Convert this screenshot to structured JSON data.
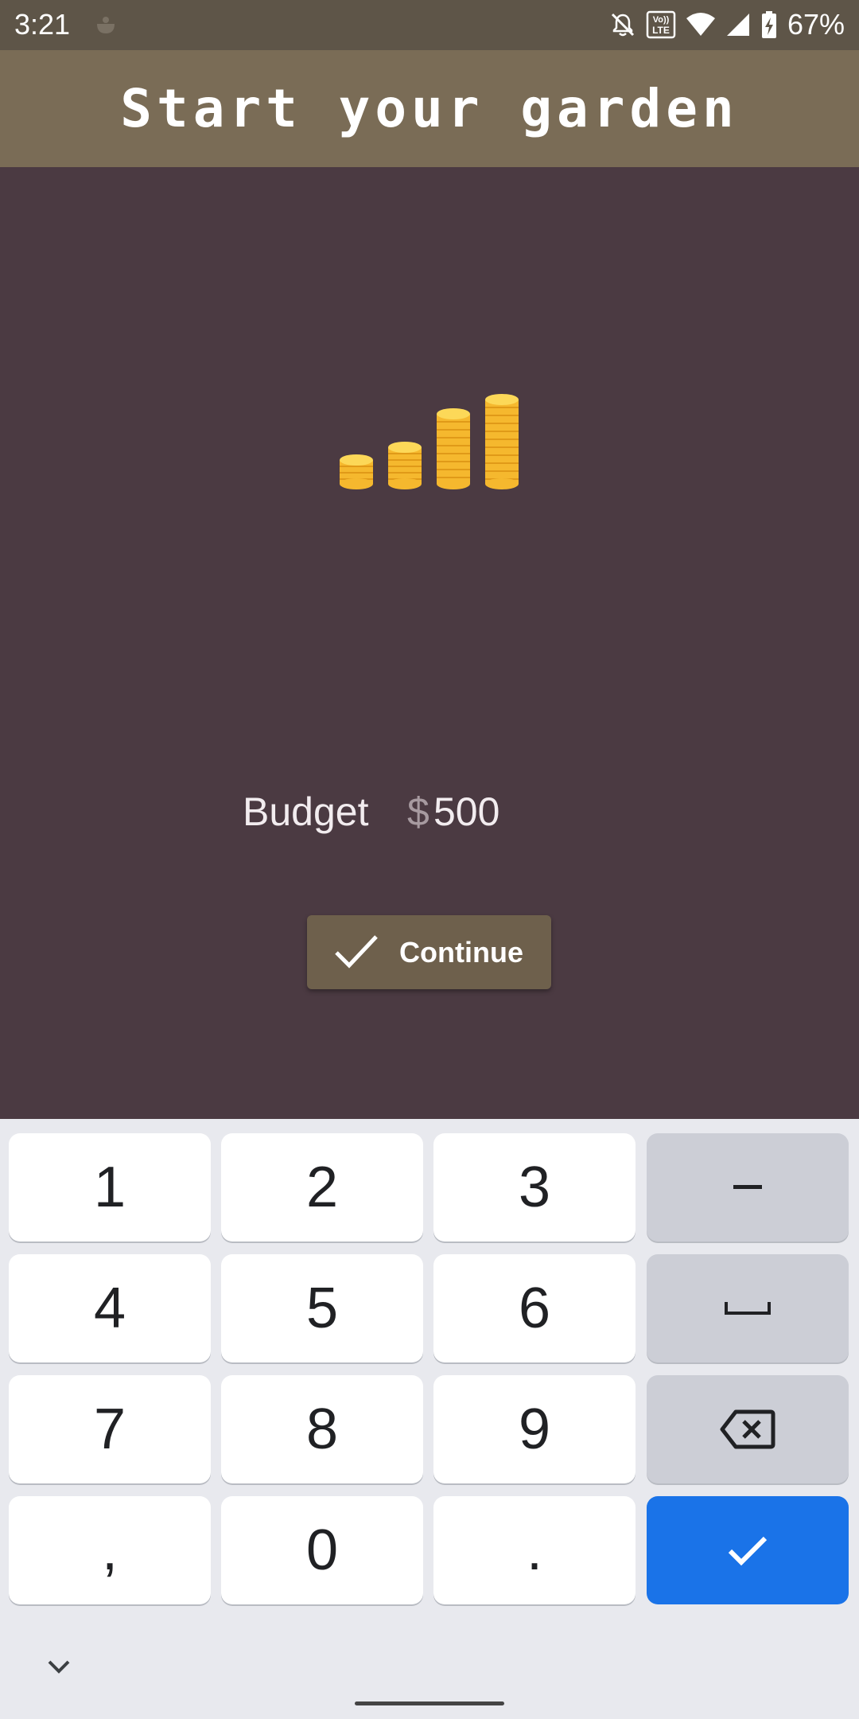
{
  "status_bar": {
    "time": "3:21",
    "lte_label_top": "Vo))",
    "lte_label_bottom": "LTE",
    "battery": "67%"
  },
  "app_bar": {
    "title": "Start your garden"
  },
  "main": {
    "illustration": "coin-stacks-icon",
    "budget_label": "Budget",
    "currency_symbol": "$",
    "budget_value": "500",
    "continue_label": "Continue"
  },
  "keyboard": {
    "keys": [
      "1",
      "2",
      "3",
      "–",
      "4",
      "5",
      "6",
      "␣",
      "7",
      "8",
      "9",
      "⌫",
      ",",
      "0",
      ".",
      "✓"
    ]
  },
  "colors": {
    "status_bar": "#5e5548",
    "app_bar": "#7a6c56",
    "background": "#4b3a42",
    "button": "#6e604c",
    "coin": "#f7c842",
    "enter_key": "#1a73e8"
  }
}
